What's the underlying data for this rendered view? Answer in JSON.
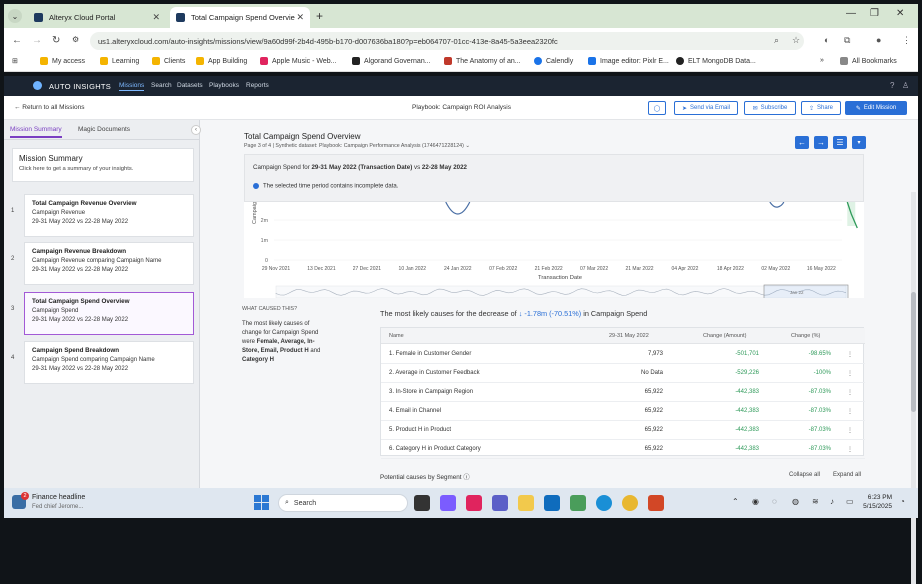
{
  "browser": {
    "tabs": [
      {
        "title": "Alteryx Cloud Portal",
        "active": false
      },
      {
        "title": "Total Campaign Spend Overvie",
        "active": true
      }
    ],
    "url": "us1.alteryxcloud.com/auto-insights/missions/view/9a60d99f-2b4d-495b-b170-d007636ba180?p=eb064707-01cc-413e-8a45-5a3eea2320fc",
    "bookmarks": [
      {
        "label": "My access",
        "color": "#f4b400"
      },
      {
        "label": "Learning",
        "color": "#f4b400"
      },
      {
        "label": "Clients",
        "color": "#f4b400"
      },
      {
        "label": "App Building",
        "color": "#f4b400"
      },
      {
        "label": "Apple Music - Web...",
        "color": "#e0245e"
      },
      {
        "label": "Algorand Governan...",
        "color": "#222222"
      },
      {
        "label": "The Anatomy of an...",
        "color": "#c0392b"
      },
      {
        "label": "Calendly",
        "color": "#1a73e8"
      },
      {
        "label": "Image editor: Pixlr E...",
        "color": "#1a73e8"
      },
      {
        "label": "ELT MongoDB Data...",
        "color": "#222222"
      }
    ],
    "all_bookmarks": "All Bookmarks"
  },
  "app": {
    "brand": "AUTO INSIGHTS",
    "nav": [
      "Missions",
      "Search",
      "Datasets",
      "Playbooks",
      "Reports"
    ]
  },
  "header": {
    "back": "← Return to all Missions",
    "playbook": "Playbook: Campaign ROI Analysis",
    "send_via_email": "Send via Email",
    "subscribe": "Subscribe",
    "share": "Share",
    "edit_mission": "Edit Mission"
  },
  "sidebar": {
    "tab_summary": "Mission Summary",
    "tab_docs": "Magic Documents",
    "summary_title": "Mission Summary",
    "summary_sub": "Click here to get a summary of your insights.",
    "steps": [
      {
        "num": "1",
        "title": "Total Campaign Revenue Overview",
        "sub": "Campaign Revenue",
        "dates": "29-31 May 2022 vs 22-28 May 2022",
        "selected": false
      },
      {
        "num": "2",
        "title": "Campaign Revenue Breakdown",
        "sub": "Campaign Revenue comparing Campaign Name",
        "dates": "29-31 May 2022 vs 22-28 May 2022",
        "selected": false
      },
      {
        "num": "3",
        "title": "Total Campaign Spend Overview",
        "sub": "Campaign Spend",
        "dates": "29-31 May 2022 vs 22-28 May 2022",
        "selected": true
      },
      {
        "num": "4",
        "title": "Campaign Spend Breakdown",
        "sub": "Campaign Spend comparing Campaign Name",
        "dates": "29-31 May 2022 vs 22-28 May 2022",
        "selected": false
      }
    ]
  },
  "main": {
    "title": "Total Campaign Spend Overview",
    "meta": "Page 3 of 4 | Synthetic dataset: Playbook: Campaign Performance Analysis (1746471228124)",
    "period_prefix": "Campaign Spend  for ",
    "period_current": "29-31 May 2022 (Transaction Date)",
    "period_mid": "  vs ",
    "period_prev": "22-28 May 2022",
    "incomplete_note": "The selected time period contains incomplete data.",
    "what_caused": "WHAT CAUSED THIS?",
    "cause_text_1": "The most likely causes of change for Campaign Spend were ",
    "cause_bold": "Female, Average, In-Store, Email, Product H",
    "cause_text_2": " and ",
    "cause_bold_2": "Category H",
    "causes_head_1": "The most likely causes for the decrease of ",
    "causes_head_neg": "↓ -1.78m (-70.51%)",
    "causes_head_2": " in Campaign Spend",
    "table": {
      "headers": [
        "Name",
        "29-31 May 2022",
        "Change (Amount)",
        "Change (%)"
      ],
      "rows": [
        [
          "1. Female in Customer Gender",
          "7,973",
          "-501,701",
          "-98.65%"
        ],
        [
          "2. Average in Customer Feedback",
          "No Data",
          "-529,226",
          "-100%"
        ],
        [
          "3. In-Store in Campaign Region",
          "65,922",
          "-442,383",
          "-87.03%"
        ],
        [
          "4. Email in Channel",
          "65,922",
          "-442,383",
          "-87.03%"
        ],
        [
          "5. Product H in Product",
          "65,922",
          "-442,383",
          "-87.03%"
        ],
        [
          "6. Category H in Product Category",
          "65,922",
          "-442,383",
          "-87.03%"
        ]
      ]
    },
    "segments": "Potential causes by Segment",
    "collapse_all": "Collapse all",
    "expand_all": "Expand all"
  },
  "chart_data": {
    "type": "line",
    "title": "",
    "xlabel": "Transaction Date",
    "ylabel": "Campaign",
    "y_ticks": [
      "0",
      "1m",
      "2m"
    ],
    "x_ticks": [
      "29 Nov 2021",
      "13 Dec 2021",
      "27 Dec 2021",
      "10 Jan 2022",
      "24 Jan 2022",
      "07 Feb 2022",
      "21 Feb 2022",
      "07 Mar 2022",
      "21 Mar 2022",
      "04 Apr 2022",
      "18 Apr 2022",
      "02 May 2022",
      "16 May 2022"
    ],
    "brush_labels": [
      "Jan 22"
    ],
    "visible_fragments": [
      {
        "x_tick": "24 Jan 2022",
        "note": "dip at top of visible area"
      },
      {
        "x_tick": "02 May 2022",
        "note": "dip at top of visible area"
      },
      {
        "x_tick": "16 May 2022",
        "note": "sharp decline at end of range"
      }
    ]
  },
  "taskbar": {
    "news_title": "Finance headline",
    "news_sub": "Fed chief Jerome...",
    "badge": "2",
    "search": "Search",
    "time": "6:23 PM",
    "date": "5/15/2025"
  }
}
